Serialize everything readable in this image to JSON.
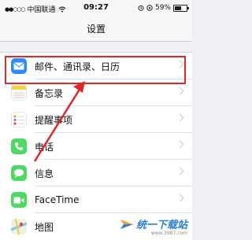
{
  "status_bar": {
    "signal": "●●○○○",
    "carrier": "中国联通",
    "wifi_icon": "wifi-icon",
    "time": "09:27",
    "battery_percent": "59%",
    "battery_level": 0.59
  },
  "nav": {
    "title": "设置"
  },
  "settings": {
    "items": [
      {
        "label": "邮件、通讯录、日历",
        "icon": "mail-icon",
        "color": "#2f8cf4"
      },
      {
        "label": "备忘录",
        "icon": "notes-icon",
        "color": "#f5d33b"
      },
      {
        "label": "提醒事项",
        "icon": "reminders-icon",
        "color": "#ffffff"
      },
      {
        "label": "电话",
        "icon": "phone-icon",
        "color": "#4cd964"
      },
      {
        "label": "信息",
        "icon": "messages-icon",
        "color": "#4cd964"
      },
      {
        "label": "FaceTime",
        "icon": "facetime-icon",
        "color": "#4cd964"
      },
      {
        "label": "地图",
        "icon": "maps-icon",
        "color": "#7fc6e8"
      }
    ]
  },
  "annotation": {
    "highlight_color": "#e0262b"
  },
  "watermark": {
    "text": "统一下载站",
    "sub": "www.3987.com"
  }
}
